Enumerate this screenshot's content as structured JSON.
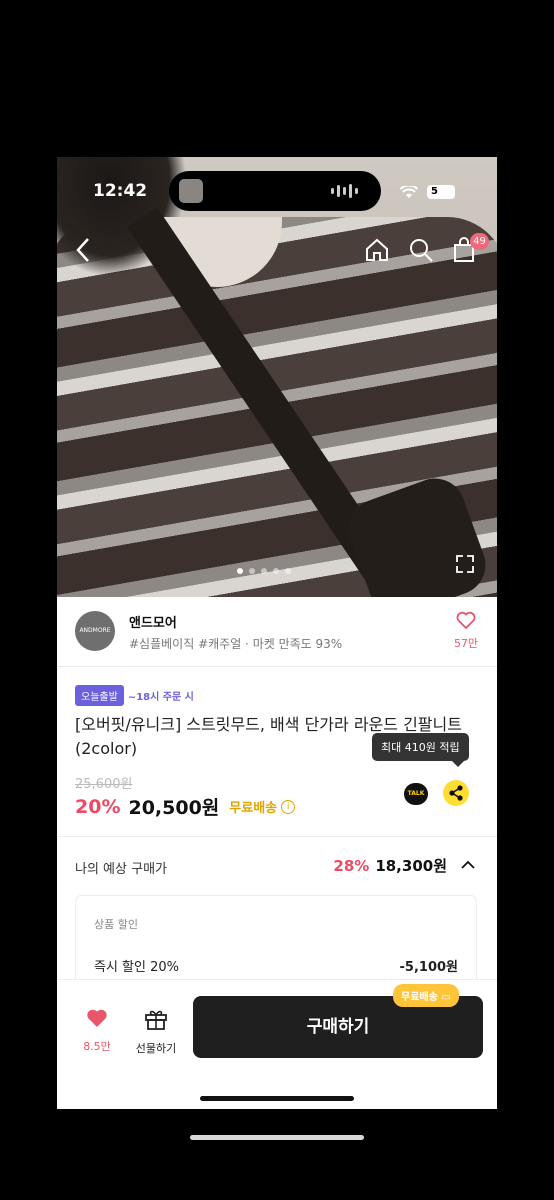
{
  "status": {
    "time": "12:42",
    "battery": "5"
  },
  "seller": {
    "logo_text": "ANDMORE",
    "name": "앤드모어",
    "tags": "#심플베이직 #캐주얼 · 마켓 만족도 93%",
    "like_count": "57만"
  },
  "nav": {
    "cart_count": "49"
  },
  "product": {
    "badge_today": "오늘출발",
    "cutoff": "~18시 주문 시",
    "title": "[오버핏/유니크] 스트릿무드, 배색 단가라 라운드 긴팔니트 (2color)",
    "tooltip": "최대 410원 적립",
    "original_price": "25,600원",
    "discount": "20%",
    "price": "20,500원",
    "free_shipping": "무료배송",
    "talk_label": "TALK"
  },
  "expected": {
    "label": "나의 예상 구매가",
    "discount": "28%",
    "price": "18,300원"
  },
  "detail": {
    "header": "상품 할인",
    "row_label": "즉시 할인 20%",
    "row_value": "-5,100원"
  },
  "bottom": {
    "like_count": "8.5만",
    "gift_label": "선물하기",
    "buy_label": "구매하기",
    "freeship_tag": "무료배송"
  },
  "colors": {
    "accent_pink": "#ee4a63",
    "accent_purple": "#6b61dc",
    "accent_yellow": "#ffc53a"
  }
}
